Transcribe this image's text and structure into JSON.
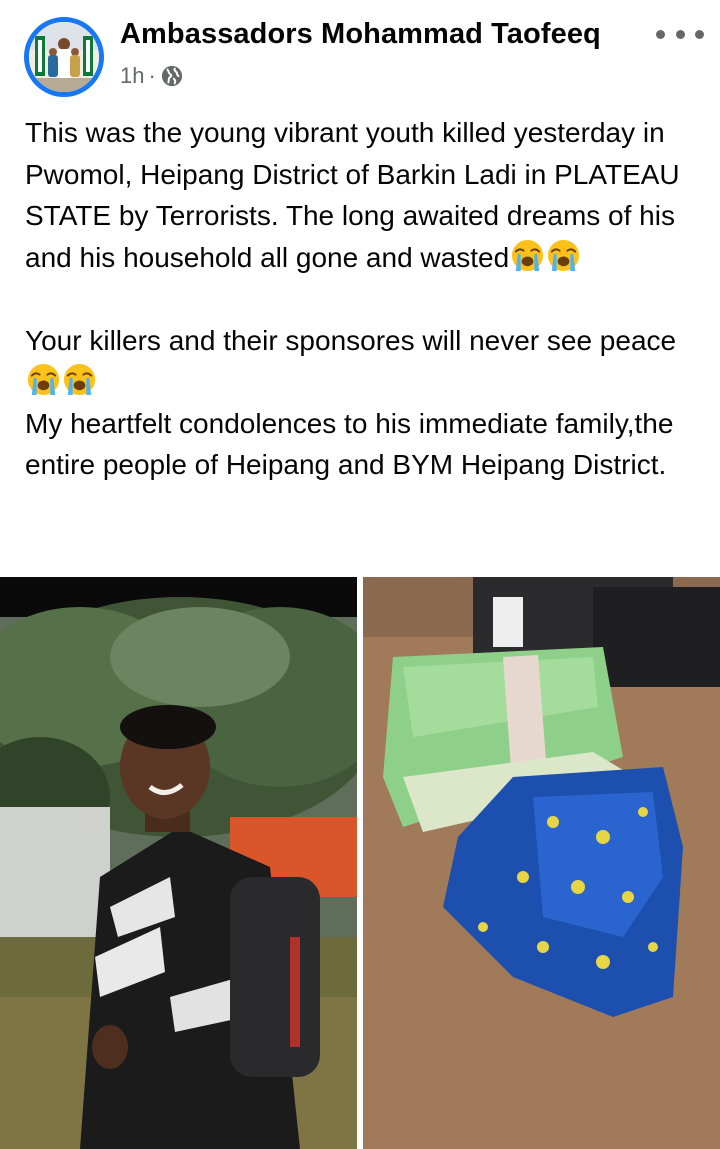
{
  "post": {
    "author": "Ambassadors Mohammad Taofeeq",
    "time": "1h",
    "separator": "·",
    "privacy_icon": "globe-icon",
    "more_icon": "more-options-icon",
    "paragraphs": [
      {
        "text": "This was the young vibrant youth killed yesterday in Pwomol, Heipang District of Barkin Ladi in PLATEAU STATE by Terrorists. The long awaited dreams of his and his household all gone and wasted",
        "emoji_count": 2
      },
      {
        "text": "Your killers and their sponsores will never see peace",
        "emoji_count": 2
      },
      {
        "text": "My heartfelt condolences to his immediate family,the entire people of Heipang and BYM Heipang District.",
        "emoji_count": 0
      }
    ],
    "emoji_icon": "loudly-crying-face-emoji"
  },
  "colors": {
    "text": "#050505",
    "secondary": "#65676b",
    "accent": "#1877f2"
  }
}
